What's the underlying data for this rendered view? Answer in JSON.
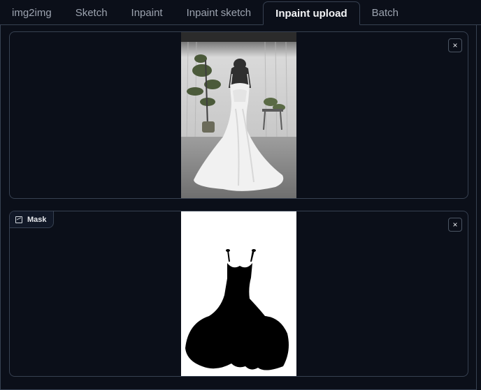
{
  "tabs": [
    {
      "label": "img2img",
      "selected": false
    },
    {
      "label": "Sketch",
      "selected": false
    },
    {
      "label": "Inpaint",
      "selected": false
    },
    {
      "label": "Inpaint sketch",
      "selected": false
    },
    {
      "label": "Inpaint upload",
      "selected": true
    },
    {
      "label": "Batch",
      "selected": false
    }
  ],
  "image_panel": {
    "close_label": "×"
  },
  "mask_panel": {
    "label": "Mask",
    "close_label": "×"
  }
}
